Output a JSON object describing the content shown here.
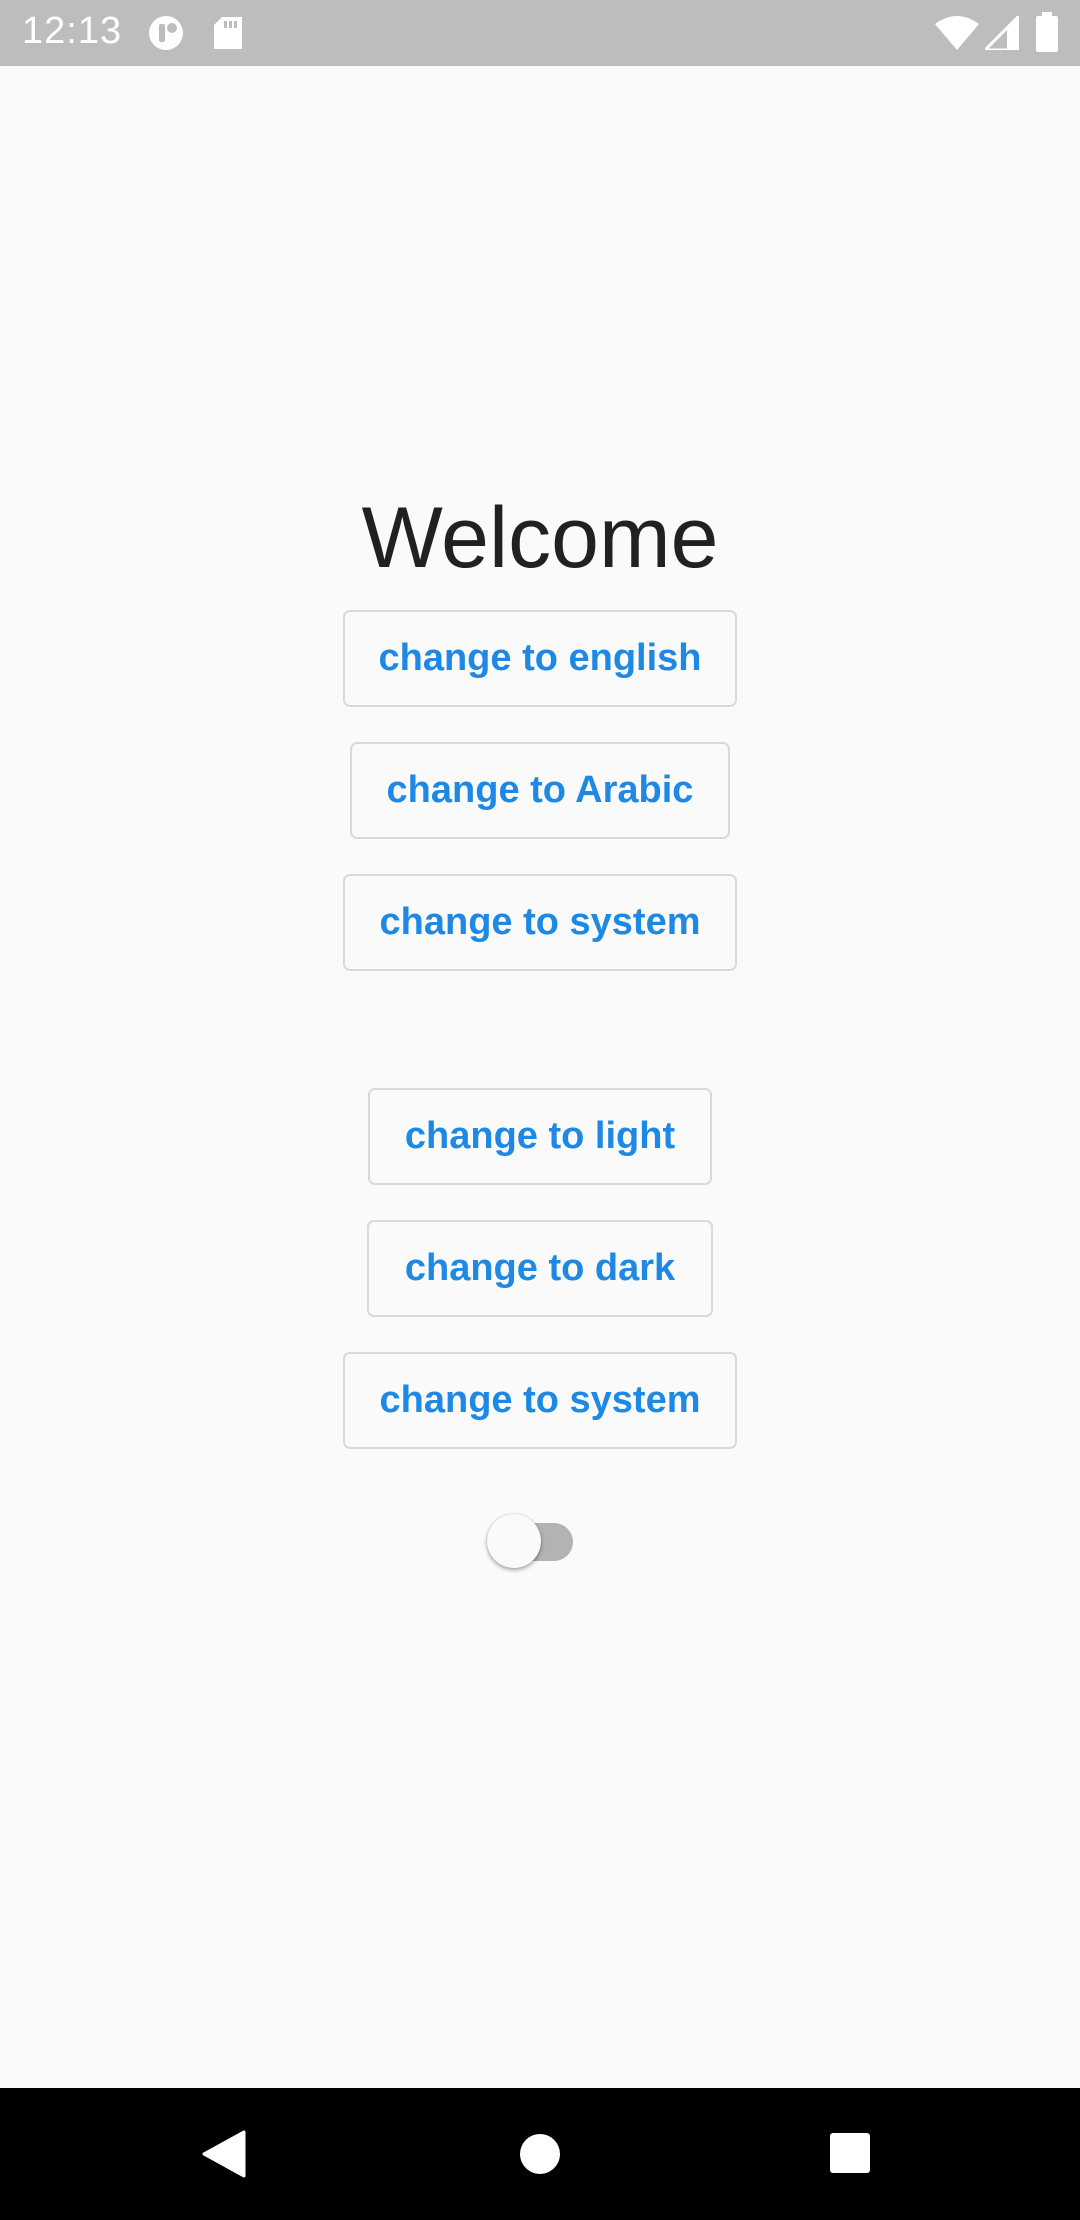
{
  "status_bar": {
    "time": "12:13",
    "icons": [
      "notification-app-icon",
      "sd-card-icon",
      "wifi-icon",
      "signal-icon",
      "battery-icon"
    ]
  },
  "main": {
    "title": "Welcome",
    "language_buttons": [
      {
        "label": "change to english"
      },
      {
        "label": "change to Arabic"
      },
      {
        "label": "change to system"
      }
    ],
    "theme_buttons": [
      {
        "label": "change to light"
      },
      {
        "label": "change to dark"
      },
      {
        "label": "change to system"
      }
    ],
    "toggle": {
      "state": "off"
    }
  },
  "nav_bar": {
    "icons": [
      "back-icon",
      "home-icon",
      "recents-icon"
    ]
  },
  "colors": {
    "accent": "#1e88e5",
    "background": "#fafafa",
    "status_bar": "#bdbdbd",
    "nav_bar": "#000000",
    "title_text": "#212121"
  }
}
